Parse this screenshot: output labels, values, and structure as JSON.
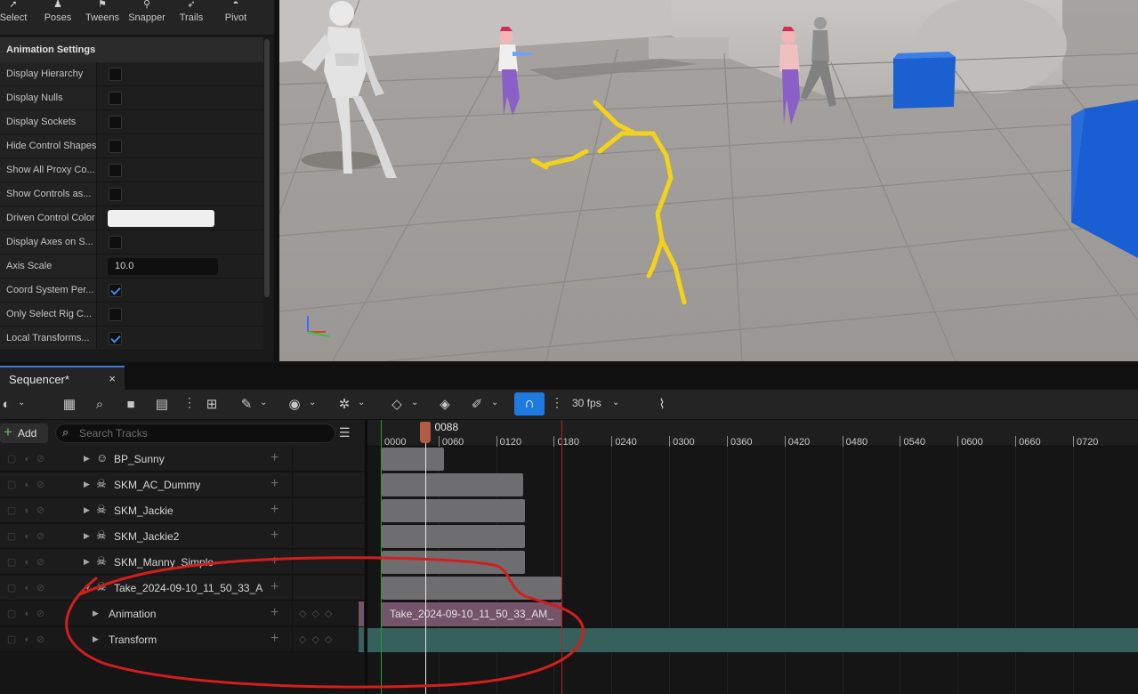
{
  "mode_toolbar": {
    "items": [
      {
        "label": "Select",
        "icon": "cursor-icon"
      },
      {
        "label": "Poses",
        "icon": "poses-icon"
      },
      {
        "label": "Tweens",
        "icon": "tweens-icon"
      },
      {
        "label": "Snapper",
        "icon": "snapper-icon"
      },
      {
        "label": "Trails",
        "icon": "trails-icon"
      },
      {
        "label": "Pivot",
        "icon": "pivot-icon"
      }
    ]
  },
  "animation_settings": {
    "header": "Animation Settings",
    "rows": [
      {
        "label": "Display Hierarchy",
        "type": "checkbox",
        "checked": false
      },
      {
        "label": "Display Nulls",
        "type": "checkbox",
        "checked": false
      },
      {
        "label": "Display Sockets",
        "type": "checkbox",
        "checked": false
      },
      {
        "label": "Hide Control Shapes",
        "type": "checkbox",
        "checked": false
      },
      {
        "label": "Show All Proxy Co...",
        "type": "checkbox",
        "checked": false
      },
      {
        "label": "Show Controls as...",
        "type": "checkbox",
        "checked": false
      },
      {
        "label": "Driven Control Color",
        "type": "color",
        "value": "#F0F0F0"
      },
      {
        "label": "Display Axes on S...",
        "type": "checkbox",
        "checked": false
      },
      {
        "label": "Axis Scale",
        "type": "number",
        "value": "10.0"
      },
      {
        "label": "Coord System Per...",
        "type": "checkbox",
        "checked": true
      },
      {
        "label": "Only Select Rig C...",
        "type": "checkbox",
        "checked": false
      },
      {
        "label": "Local Transforms...",
        "type": "checkbox",
        "checked": true
      }
    ]
  },
  "sequencer": {
    "tab_title": "Sequencer*",
    "tab_close": "×",
    "add_label": "Add",
    "search_placeholder": "Search Tracks",
    "fps": "30 fps",
    "playhead_label": "0088",
    "tracks": [
      {
        "name": "BP_Sunny",
        "icon": "blueprint-icon",
        "expanded": false,
        "child": false
      },
      {
        "name": "SKM_AC_Dummy",
        "icon": "skeleton-icon",
        "expanded": false,
        "child": false
      },
      {
        "name": "SKM_Jackie",
        "icon": "skeleton-icon",
        "expanded": false,
        "child": false
      },
      {
        "name": "SKM_Jackie2",
        "icon": "skeleton-icon",
        "expanded": false,
        "child": false
      },
      {
        "name": "SKM_Manny_Simple",
        "icon": "skeleton-icon",
        "expanded": false,
        "child": false
      },
      {
        "name": "Take_2024-09-10_11_50_33_A",
        "icon": "skeleton-icon",
        "expanded": true,
        "child": false
      },
      {
        "name": "Animation",
        "icon": "",
        "expanded": false,
        "child": true
      },
      {
        "name": "Transform",
        "icon": "",
        "expanded": false,
        "child": true
      }
    ],
    "ruler_ticks": [
      "0000",
      "0060",
      "0120",
      "0180",
      "0240",
      "0300",
      "0360",
      "0420",
      "0480",
      "0540",
      "0600",
      "0660",
      "0720"
    ],
    "animation_section_label": "Take_2024-09-10_11_50_33_AM_",
    "section_end_frames": [
      130,
      295,
      298,
      298,
      298,
      373
    ],
    "playhead_frame": 88,
    "play_range_end_frame": 373
  },
  "colors": {
    "accent": "#1F7AE0",
    "animation_section": "#73546A",
    "transform_section": "#35605C",
    "annotation": "#D41E1E"
  }
}
